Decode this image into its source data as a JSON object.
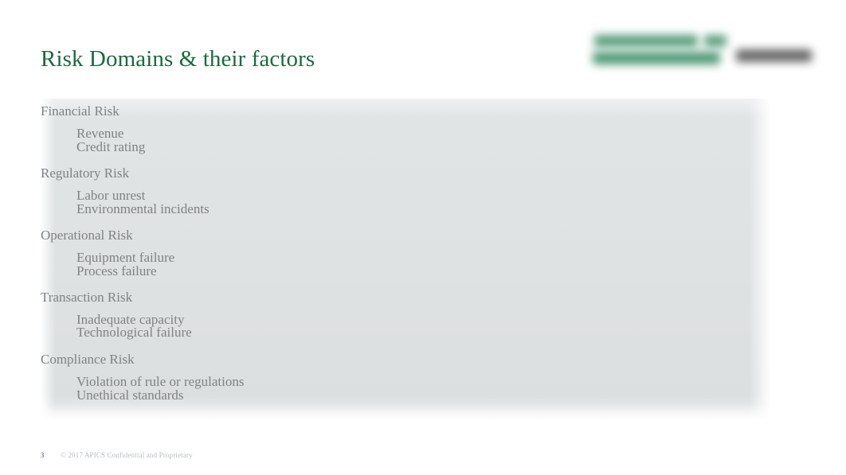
{
  "slide": {
    "title": "Risk Domains & their factors",
    "title_color": "#1a6b3c",
    "body_text_color": "#808285",
    "panel_color": "#dfe2e3"
  },
  "logo": {
    "primary_name": "logo-primary-blurred",
    "primary_color": "#3f8f69",
    "secondary_name": "logo-secondary-blurred",
    "secondary_color": "#5c5c5c"
  },
  "risk_domains": [
    {
      "domain": "Financial Risk",
      "factors": [
        "Revenue",
        "Credit rating"
      ]
    },
    {
      "domain": "Regulatory Risk",
      "factors": [
        "Labor unrest",
        "Environmental incidents"
      ]
    },
    {
      "domain": "Operational Risk",
      "factors": [
        "Equipment failure",
        "Process failure"
      ]
    },
    {
      "domain": "Transaction Risk",
      "factors": [
        "Inadequate capacity",
        "Technological failure"
      ]
    },
    {
      "domain": "Compliance Risk",
      "factors": [
        "Violation of rule or regulations",
        " Unethical standards"
      ]
    }
  ],
  "footer": {
    "slide_number": "3",
    "copyright": "© 2017 APICS Confidential and Proprietary"
  }
}
